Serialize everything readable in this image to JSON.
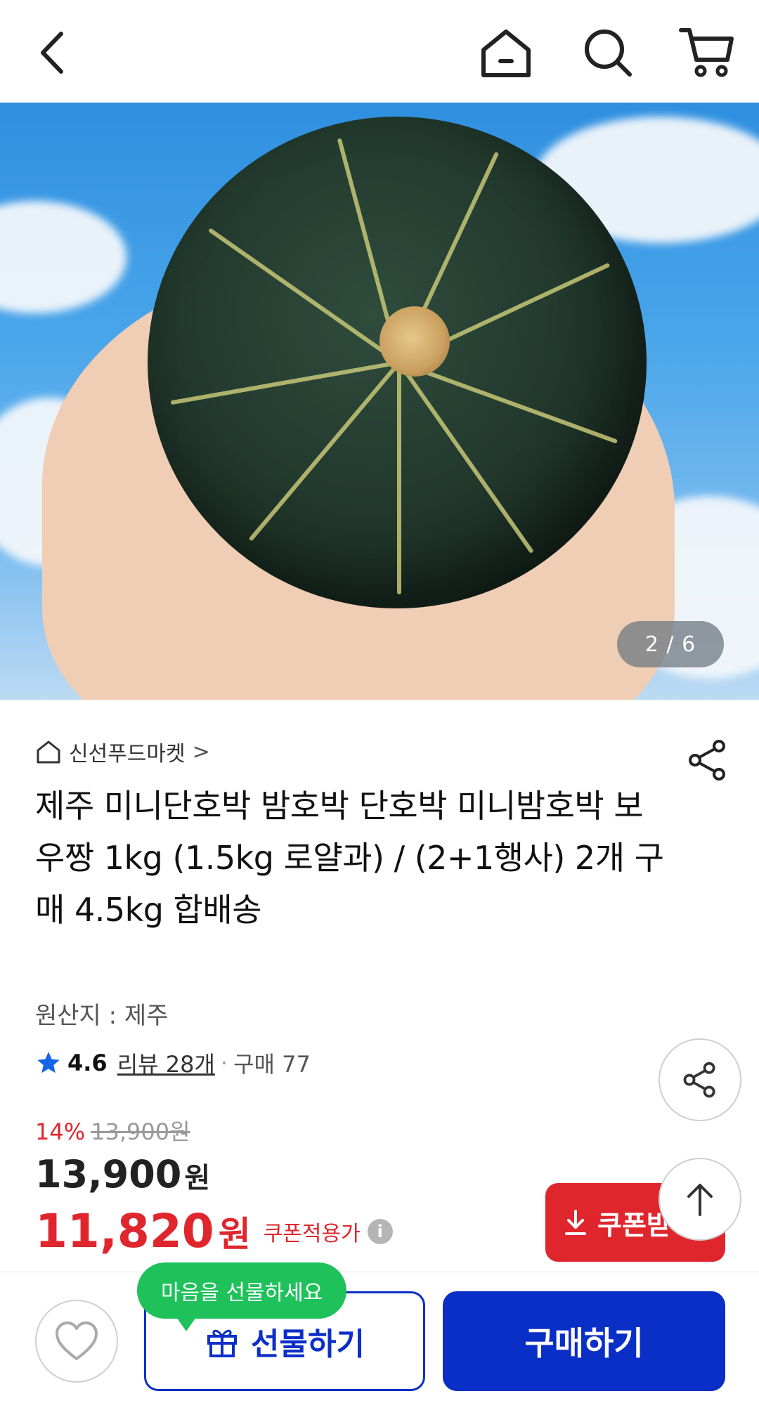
{
  "topbar": {
    "icons": [
      "back-icon",
      "home-icon",
      "search-icon",
      "cart-icon"
    ]
  },
  "gallery": {
    "counter": "2 / 6"
  },
  "product": {
    "store_name": "신선푸드마켓",
    "store_chevron": ">",
    "title": "제주 미니단호박 밤호박 단호박 미니밤호박  보우짱 1kg (1.5kg 로얄과) / (2+1행사) 2개 구매 4.5kg 합배송",
    "origin": "원산지 : 제주",
    "rating": "4.6",
    "review_text": "리뷰 28개",
    "separator": "·",
    "purchase_text": "구매 77",
    "discount_percent": "14%",
    "original_price": "13,900원",
    "price_number": "13,900",
    "price_unit": "원",
    "coupon_price_number": "11,820",
    "coupon_price_unit": "원",
    "coupon_price_label": "쿠폰적용가",
    "info_mark": "i",
    "coupon_button_label": "쿠폰받"
  },
  "bottom": {
    "tooltip": "마음을 선물하세요",
    "gift_label": "선물하기",
    "buy_label": "구매하기"
  },
  "colors": {
    "accent_red": "#e0262d",
    "brand_blue": "#0a2fc6",
    "tooltip_green": "#1ec15a",
    "star_blue": "#1565e6"
  }
}
